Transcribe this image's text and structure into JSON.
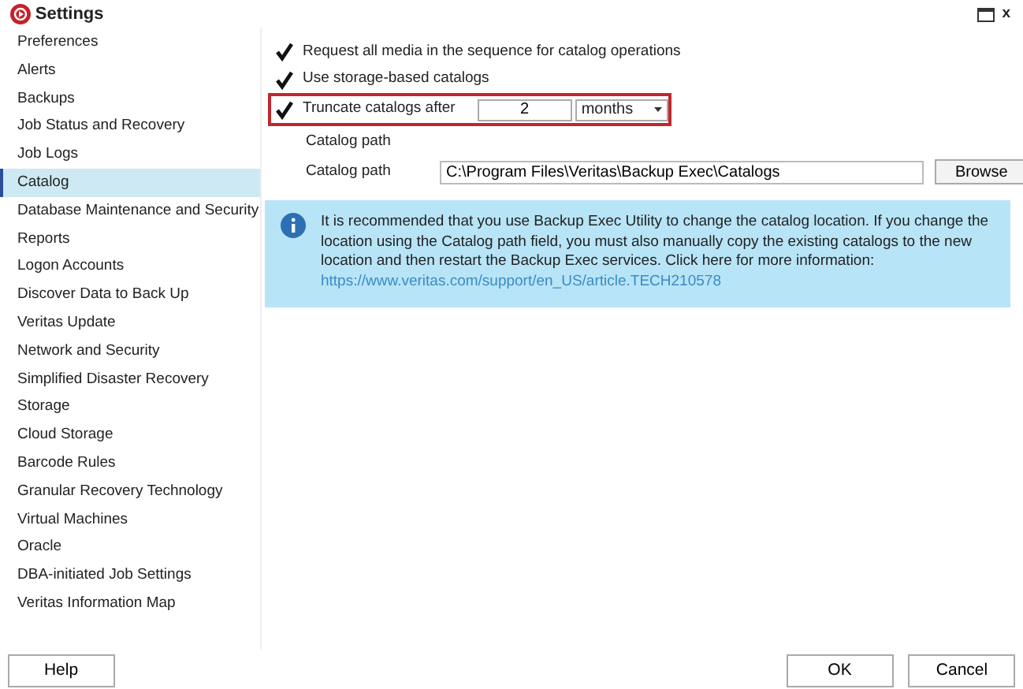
{
  "window": {
    "title": "Settings",
    "close": "x"
  },
  "sidebar": {
    "items": [
      {
        "label": "Preferences",
        "selected": false
      },
      {
        "label": "Alerts",
        "selected": false
      },
      {
        "label": "Backups",
        "selected": false
      },
      {
        "label": "Job Status and Recovery",
        "selected": false
      },
      {
        "label": "Job Logs",
        "selected": false
      },
      {
        "label": "Catalog",
        "selected": true
      },
      {
        "label": "Database Maintenance and Security",
        "selected": false
      },
      {
        "label": "Reports",
        "selected": false
      },
      {
        "label": "Logon Accounts",
        "selected": false
      },
      {
        "label": "Discover Data to Back Up",
        "selected": false
      },
      {
        "label": "Veritas Update",
        "selected": false
      },
      {
        "label": "Network and Security",
        "selected": false
      },
      {
        "label": "Simplified Disaster Recovery",
        "selected": false
      },
      {
        "label": "Storage",
        "selected": false
      },
      {
        "label": "Cloud Storage",
        "selected": false
      },
      {
        "label": "Barcode Rules",
        "selected": false
      },
      {
        "label": "Granular Recovery Technology",
        "selected": false
      },
      {
        "label": "Virtual Machines",
        "selected": false
      },
      {
        "label": "Oracle",
        "selected": false
      },
      {
        "label": "DBA-initiated Job Settings",
        "selected": false
      },
      {
        "label": "Veritas Information Map",
        "selected": false
      }
    ]
  },
  "options": [
    {
      "label": "Request all media in the sequence for catalog operations",
      "checked": true
    },
    {
      "label": "Use storage-based catalogs",
      "checked": true
    }
  ],
  "truncate": {
    "label": "Truncate catalogs after",
    "checked": true,
    "highlighted": true,
    "amount": "2",
    "unit": "months"
  },
  "catalog_path_heading": "Catalog path",
  "catalog_path": {
    "label": "Catalog path",
    "value": "C:\\Program Files\\Veritas\\Backup Exec\\Catalogs",
    "button": "Browse"
  },
  "info": {
    "text": "It is recommended that you use Backup Exec Utility to change the catalog location. If you change the location using the Catalog path field, you must also manually copy the existing catalogs to the new location and then restart the Backup Exec services. Click here for more information:",
    "link": "https://www.veritas.com/support/en_US/article.TECH210578"
  },
  "footer": {
    "help": "Help",
    "ok": "OK",
    "cancel": "Cancel"
  }
}
